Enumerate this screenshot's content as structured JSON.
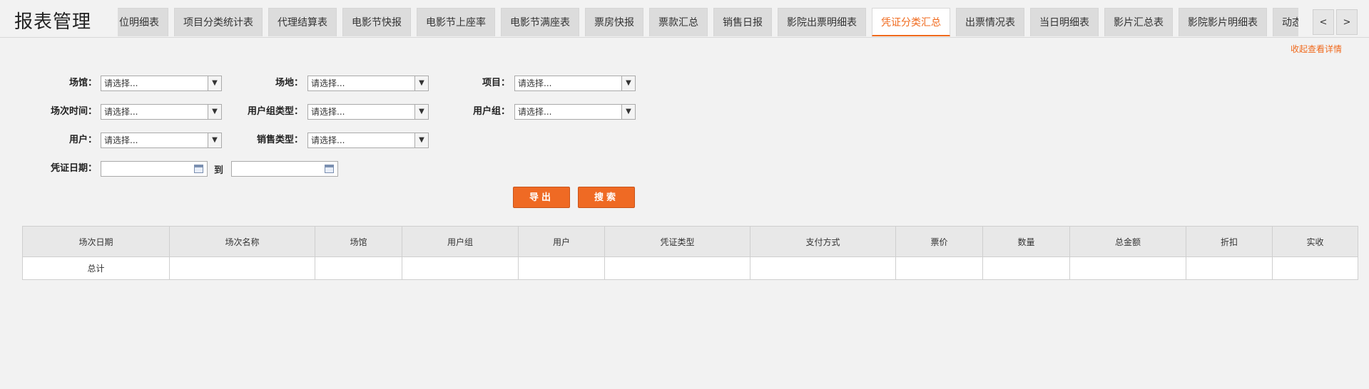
{
  "page": {
    "title": "报表管理"
  },
  "tabs": [
    {
      "label": "位明细表",
      "active": false
    },
    {
      "label": "项目分类统计表",
      "active": false
    },
    {
      "label": "代理结算表",
      "active": false
    },
    {
      "label": "电影节快报",
      "active": false
    },
    {
      "label": "电影节上座率",
      "active": false
    },
    {
      "label": "电影节满座表",
      "active": false
    },
    {
      "label": "票房快报",
      "active": false
    },
    {
      "label": "票款汇总",
      "active": false
    },
    {
      "label": "销售日报",
      "active": false
    },
    {
      "label": "影院出票明细表",
      "active": false
    },
    {
      "label": "凭证分类汇总",
      "active": true
    },
    {
      "label": "出票情况表",
      "active": false
    },
    {
      "label": "当日明细表",
      "active": false
    },
    {
      "label": "影片汇总表",
      "active": false
    },
    {
      "label": "影院影片明细表",
      "active": false
    },
    {
      "label": "动态报表",
      "active": false
    }
  ],
  "nav": {
    "prev": "<",
    "next": ">"
  },
  "collapse_link": "收起查看详情",
  "filters": {
    "venue": {
      "label": "场馆：",
      "value": "请选择..."
    },
    "site": {
      "label": "场地：",
      "value": "请选择..."
    },
    "item": {
      "label": "项目：",
      "value": "请选择..."
    },
    "session_time": {
      "label": "场次时间：",
      "value": "请选择..."
    },
    "user_group_type": {
      "label": "用户组类型：",
      "value": "请选择..."
    },
    "user_group": {
      "label": "用户组：",
      "value": "请选择..."
    },
    "user": {
      "label": "用户：",
      "value": "请选择..."
    },
    "sale_type": {
      "label": "销售类型：",
      "value": "请选择..."
    },
    "voucher_date": {
      "label": "凭证日期：",
      "to": "到",
      "from_value": "",
      "to_value": ""
    }
  },
  "buttons": {
    "export": "导出",
    "search": "搜索"
  },
  "table": {
    "columns": [
      "场次日期",
      "场次名称",
      "场馆",
      "用户组",
      "用户",
      "凭证类型",
      "支付方式",
      "票价",
      "数量",
      "总金额",
      "折扣",
      "实收"
    ],
    "total_label": "总计"
  },
  "colors": {
    "accent": "#f06a1d",
    "button": "#ef6a24"
  }
}
